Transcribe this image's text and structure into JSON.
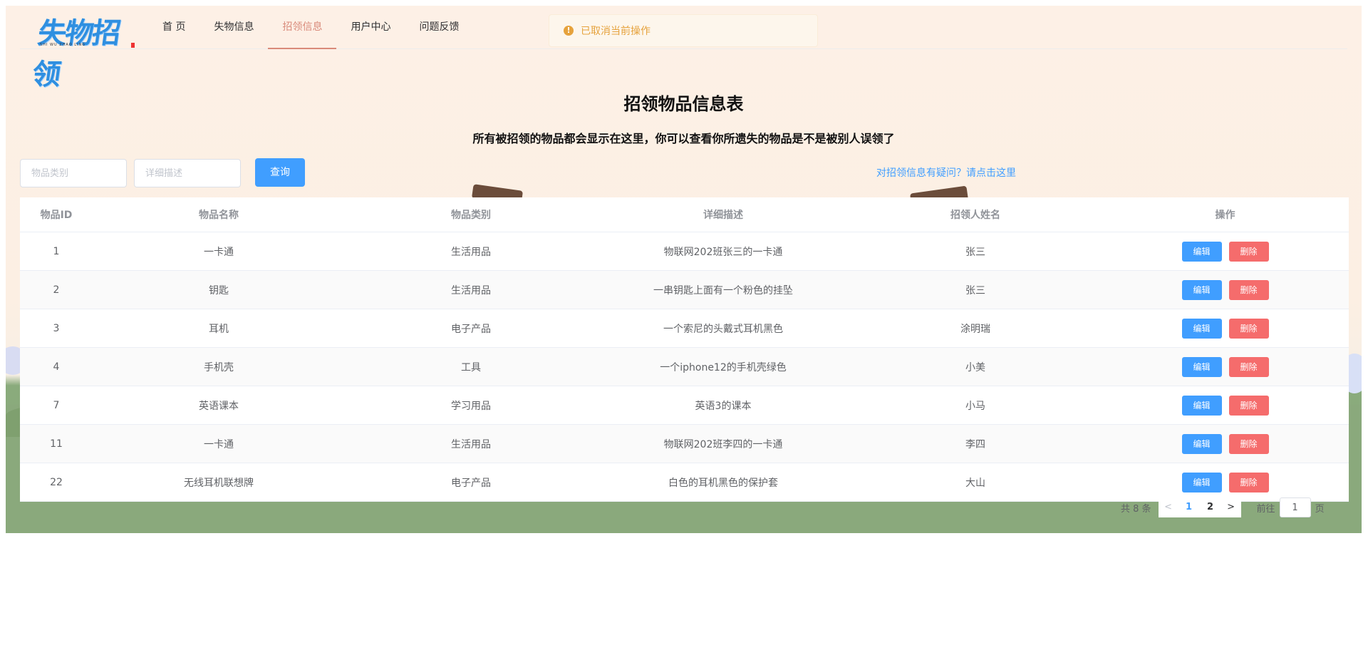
{
  "header": {
    "logo_text": "失物招领",
    "logo_sub": "SHI WU ZHAO LING",
    "nav": [
      {
        "label": "首 页",
        "active": false
      },
      {
        "label": "失物信息",
        "active": false
      },
      {
        "label": "招领信息",
        "active": true
      },
      {
        "label": "用户中心",
        "active": false
      },
      {
        "label": "问题反馈",
        "active": false
      }
    ]
  },
  "toast": {
    "icon": "!",
    "text": "已取消当前操作",
    "icon_name": "warning-icon"
  },
  "page": {
    "title": "招领物品信息表",
    "subtitle": "所有被招领的物品都会显示在这里，你可以查看你所遗失的物品是不是被别人误领了"
  },
  "search": {
    "category_placeholder": "物品类别",
    "desc_placeholder": "详细描述",
    "query_label": "查询",
    "help_link": "对招领信息有疑问？请点击这里"
  },
  "table": {
    "headers": [
      "物品ID",
      "物品名称",
      "物品类别",
      "详细描述",
      "招领人姓名",
      "操作"
    ],
    "edit_label": "编辑",
    "delete_label": "删除",
    "rows": [
      {
        "id": "1",
        "name": "一卡通",
        "category": "生活用品",
        "desc": "物联网202班张三的一卡通",
        "claimer": "张三"
      },
      {
        "id": "2",
        "name": "钥匙",
        "category": "生活用品",
        "desc": "一串钥匙上面有一个粉色的挂坠",
        "claimer": "张三"
      },
      {
        "id": "3",
        "name": "耳机",
        "category": "电子产品",
        "desc": "一个索尼的头戴式耳机黑色",
        "claimer": "涂明瑞"
      },
      {
        "id": "4",
        "name": "手机壳",
        "category": "工具",
        "desc": "一个iphone12的手机壳绿色",
        "claimer": "小美"
      },
      {
        "id": "7",
        "name": "英语课本",
        "category": "学习用品",
        "desc": "英语3的课本",
        "claimer": "小马"
      },
      {
        "id": "11",
        "name": "一卡通",
        "category": "生活用品",
        "desc": "物联网202班李四的一卡通",
        "claimer": "李四"
      },
      {
        "id": "22",
        "name": "无线耳机联想牌",
        "category": "电子产品",
        "desc": "白色的耳机黑色的保护套",
        "claimer": "大山"
      }
    ]
  },
  "pagination": {
    "total_text": "共 8 条",
    "prev": "<",
    "next": ">",
    "pages": [
      "1",
      "2"
    ],
    "current": "1",
    "goto_label": "前往",
    "goto_value": "1",
    "page_unit": "页"
  },
  "colors": {
    "primary": "#409eff",
    "danger": "#f56c6c",
    "warning": "#e6a23c",
    "nav_active": "#d98a7a"
  }
}
